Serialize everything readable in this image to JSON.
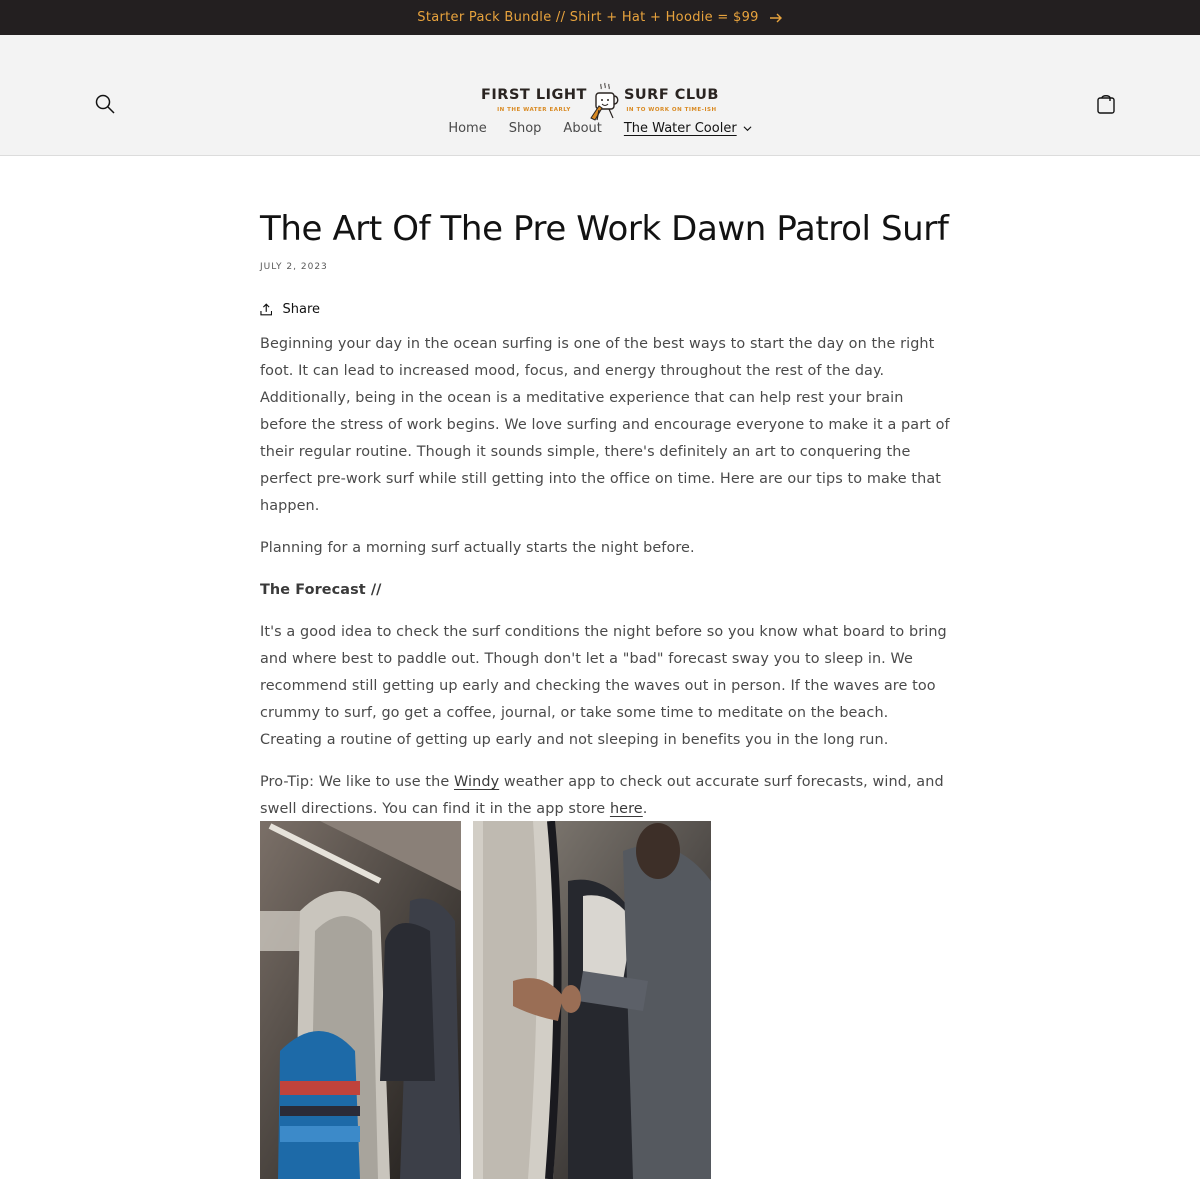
{
  "announcement": {
    "text": "Starter Pack Bundle // Shirt + Hat + Hoodie = $99",
    "arrow_icon": "arrow-right-icon"
  },
  "header": {
    "search_icon": "search-icon",
    "cart_icon": "cart-icon",
    "logo": {
      "left_main": "FIRST LIGHT",
      "left_sub": "IN THE WATER EARLY",
      "right_main": "SURF CLUB",
      "right_sub": "IN TO WORK ON TIME-ISH",
      "mug_icon": "coffee-mug-surfboard-icon"
    }
  },
  "nav": {
    "items": [
      {
        "label": "Home"
      },
      {
        "label": "Shop"
      },
      {
        "label": "About"
      },
      {
        "label": "The Water Cooler",
        "active": true,
        "has_dropdown": true
      }
    ]
  },
  "article": {
    "title": "The Art Of The Pre Work Dawn Patrol Surf",
    "date": "JULY 2, 2023",
    "share_label": "Share",
    "paragraphs": {
      "p1": "Beginning your day in the ocean surfing is one of the best ways to start the day on the right foot. It can lead to increased mood, focus, and energy throughout the rest of the day. Additionally, being in the ocean is a meditative experience that can help rest your brain before the stress of work begins. We love surfing and encourage everyone to make it a part of their regular routine. Though it sounds simple, there's definitely an art to conquering the perfect pre-work surf while still getting into the office on time. Here are our tips to make that happen.",
      "p2": "Planning for a morning surf actually starts the night before.",
      "heading1": "The Forecast //",
      "p3": "It's a good idea to check the surf conditions the night before so you know what board to bring and where best to paddle out. Though don't let a \"bad\" forecast sway you to sleep in. We recommend still getting up early and checking the waves out in person. If the waves are too crummy to surf, go get a coffee, journal, or take some time to meditate on the beach. Creating a routine of getting up early and not sleeping in benefits you in the long run.",
      "p4_before": "Pro-Tip: We like to use the ",
      "p4_link1": "Windy",
      "p4_middle": " weather app to check out accurate surf forecasts, wind, and swell directions. You can find it in the app store ",
      "p4_link2": "here",
      "p4_after": "."
    }
  },
  "colors": {
    "announcement_bg": "#231f20",
    "announcement_text": "#e8a33d",
    "header_bg": "#f3f3f3",
    "logo_accent": "#d98a22"
  }
}
